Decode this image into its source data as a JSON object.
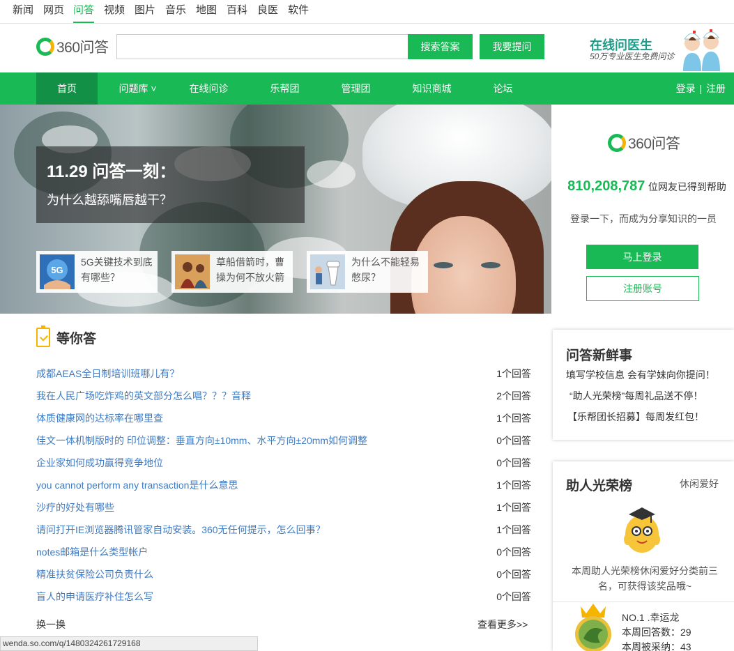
{
  "topnav": [
    {
      "label": "新闻",
      "active": false
    },
    {
      "label": "网页",
      "active": false
    },
    {
      "label": "问答",
      "active": true
    },
    {
      "label": "视频",
      "active": false
    },
    {
      "label": "图片",
      "active": false
    },
    {
      "label": "音乐",
      "active": false
    },
    {
      "label": "地图",
      "active": false
    },
    {
      "label": "百科",
      "active": false
    },
    {
      "label": "良医",
      "active": false
    },
    {
      "label": "软件",
      "active": false
    }
  ],
  "header": {
    "logo_text": "360问答",
    "search_value": "",
    "search_button": "搜索答案",
    "ask_button": "我要提问",
    "doctor_title": "在线问医生",
    "doctor_sub": "50万专业医生免费问诊"
  },
  "mainnav": {
    "items": [
      {
        "label": "首页",
        "active": true
      },
      {
        "label": "问题库 ˅",
        "active": false
      },
      {
        "label": "在线问诊",
        "active": false
      },
      {
        "label": "乐帮团",
        "active": false
      },
      {
        "label": "管理团",
        "active": false
      },
      {
        "label": "知识商城",
        "active": false
      },
      {
        "label": "论坛",
        "active": false
      }
    ],
    "login": "登录",
    "separator": "|",
    "register": "注册"
  },
  "banner": {
    "feature_title": "11.29 问答一刻：",
    "feature_question": "为什么越舔嘴唇越干？",
    "cards": [
      {
        "line1": "5G关键技术到底",
        "line2": "有哪些？",
        "thumb_icon": "5g-globe-icon",
        "thumb_label": "5G"
      },
      {
        "line1": "草船借箭时，曹",
        "line2": "操为何不放火箭",
        "thumb_icon": "painting-icon"
      },
      {
        "line1": "为什么不能轻易",
        "line2": "憋尿？",
        "thumb_icon": "toilet-icon"
      }
    ]
  },
  "login_panel": {
    "logo_text": "360问答",
    "count": "810,208,787",
    "count_unit": "位网友已得到帮助",
    "desc": "登录一下，而成为分享知识的一员",
    "login_button": "马上登录",
    "register_button": "注册账号"
  },
  "waiting": {
    "title": "等你答",
    "questions": [
      {
        "q": "成都AEAS全日制培训班哪儿有？",
        "a": "1个回答"
      },
      {
        "q": "我在人民广场吃炸鸡的英文部分怎么唱？？？音释",
        "a": "2个回答"
      },
      {
        "q": "体质健康网的达标率在哪里查",
        "a": "1个回答"
      },
      {
        "q": "佳文一体机制版时的 印位调整：垂直方向±10mm、水平方向±20mm如何调整",
        "a": "0个回答"
      },
      {
        "q": "企业家如何成功赢得竞争地位",
        "a": "0个回答"
      },
      {
        "q": "you cannot perform any transaction是什么意思",
        "a": "1个回答"
      },
      {
        "q": "沙疗的好处有哪些",
        "a": "1个回答"
      },
      {
        "q": "请问打开IE浏览器腾讯管家自动安装。360无任何提示，怎么回事？",
        "a": "1个回答"
      },
      {
        "q": "notes邮箱是什么类型帐户",
        "a": "0个回答"
      },
      {
        "q": "精准扶贫保险公司负责什么",
        "a": "0个回答"
      },
      {
        "q": "盲人的申请医疗补住怎么写",
        "a": "0个回答"
      }
    ],
    "refresh": "换一换",
    "more": "查看更多>>"
  },
  "news": {
    "title": "问答新鲜事",
    "items": [
      "填写学校信息 会有学妹向你提问！",
      "“助人光荣榜”每周礼品送不停！",
      "【乐帮团长招募】每周发红包！"
    ]
  },
  "honor": {
    "title": "助人光荣榜",
    "category": "休闲爱好",
    "desc": "本周助人光荣榜休闲爱好分类前三名，可获得该奖品哦~",
    "rank": "NO.1 .幸运龙",
    "stat_answers": "本周回答数：29",
    "stat_adopted": "本周被采纳：43"
  },
  "statusbar": {
    "url": "wenda.so.com/q/1480324261729168"
  },
  "colors": {
    "brand_green": "#19b955",
    "nav_active": "#129146",
    "link_blue": "#3e7bc3",
    "accent_orange": "#f4b400"
  }
}
